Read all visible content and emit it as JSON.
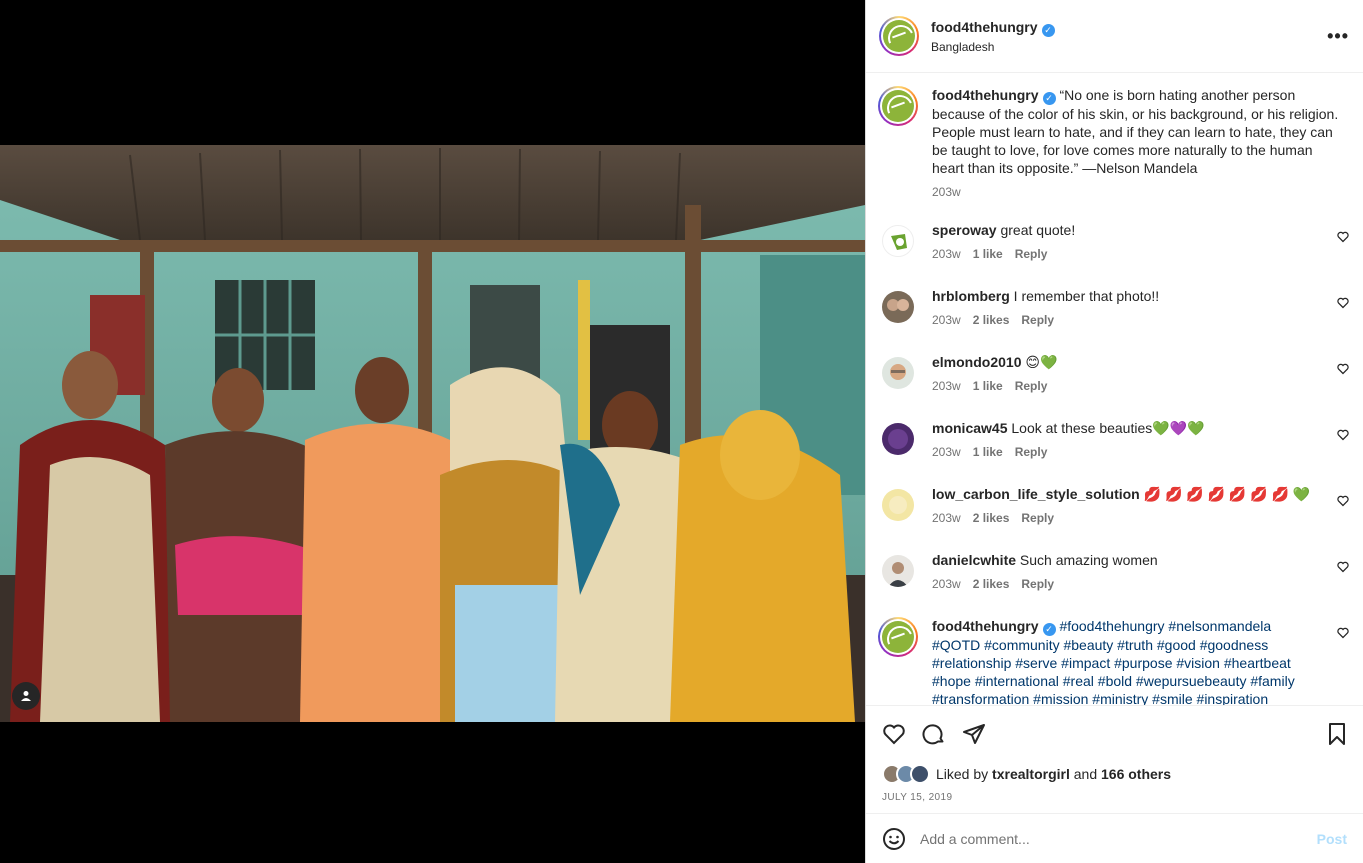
{
  "post": {
    "username": "food4thehungry",
    "location": "Bangladesh",
    "more_label": "•••"
  },
  "caption": {
    "username": "food4thehungry",
    "text": "“No one is born hating another person because of the color of his skin, or his background, or his religion. People must learn to hate, and if they can learn to hate, they can be taught to love, for love comes more naturally to the human heart than its opposite.” —Nelson Mandela",
    "time": "203w"
  },
  "comments": [
    {
      "username": "speroway",
      "text": "great quote!",
      "time": "203w",
      "likes": "1 like",
      "reply": "Reply",
      "avatar_color": "#ffffff"
    },
    {
      "username": "hrblomberg",
      "text": "I remember that photo!!",
      "time": "203w",
      "likes": "2 likes",
      "reply": "Reply",
      "avatar_color": "#7a6a58"
    },
    {
      "username": "elmondo2010",
      "text": "😊💚",
      "time": "203w",
      "likes": "1 like",
      "reply": "Reply",
      "avatar_color": "#c9a98a"
    },
    {
      "username": "monicaw45",
      "text": "Look at these beauties💚💜💚",
      "time": "203w",
      "likes": "1 like",
      "reply": "Reply",
      "avatar_color": "#4b2a6b"
    },
    {
      "username": "low_carbon_life_style_solution",
      "text": "💋 💋 💋 💋 💋 💋 💋 💚",
      "time": "203w",
      "likes": "2 likes",
      "reply": "Reply",
      "avatar_color": "#f3e6a4"
    },
    {
      "username": "danielcwhite",
      "text": "Such amazing women",
      "time": "203w",
      "likes": "2 likes",
      "reply": "Reply",
      "avatar_color": "#9a8f86"
    }
  ],
  "hashtags_comment": {
    "username": "food4thehungry",
    "text": "#food4thehungry #nelsonmandela #QOTD #community #beauty #truth #good #goodness #relationship #serve #impact #purpose #vision #heartbeat #hope #international #real #bold #wepursuebeauty #family #transformation #mission #ministry #smile #inspiration"
  },
  "likes": {
    "prefix": "Liked by",
    "user": "txrealtorgirl",
    "and": "and",
    "others": "166 others"
  },
  "date": "JULY 15, 2019",
  "comment_input": {
    "placeholder": "Add a comment...",
    "post_label": "Post"
  },
  "colors": {
    "link": "#00376b",
    "verified": "#3897f0",
    "muted": "#737373",
    "post_disabled": "#b2dffc"
  }
}
